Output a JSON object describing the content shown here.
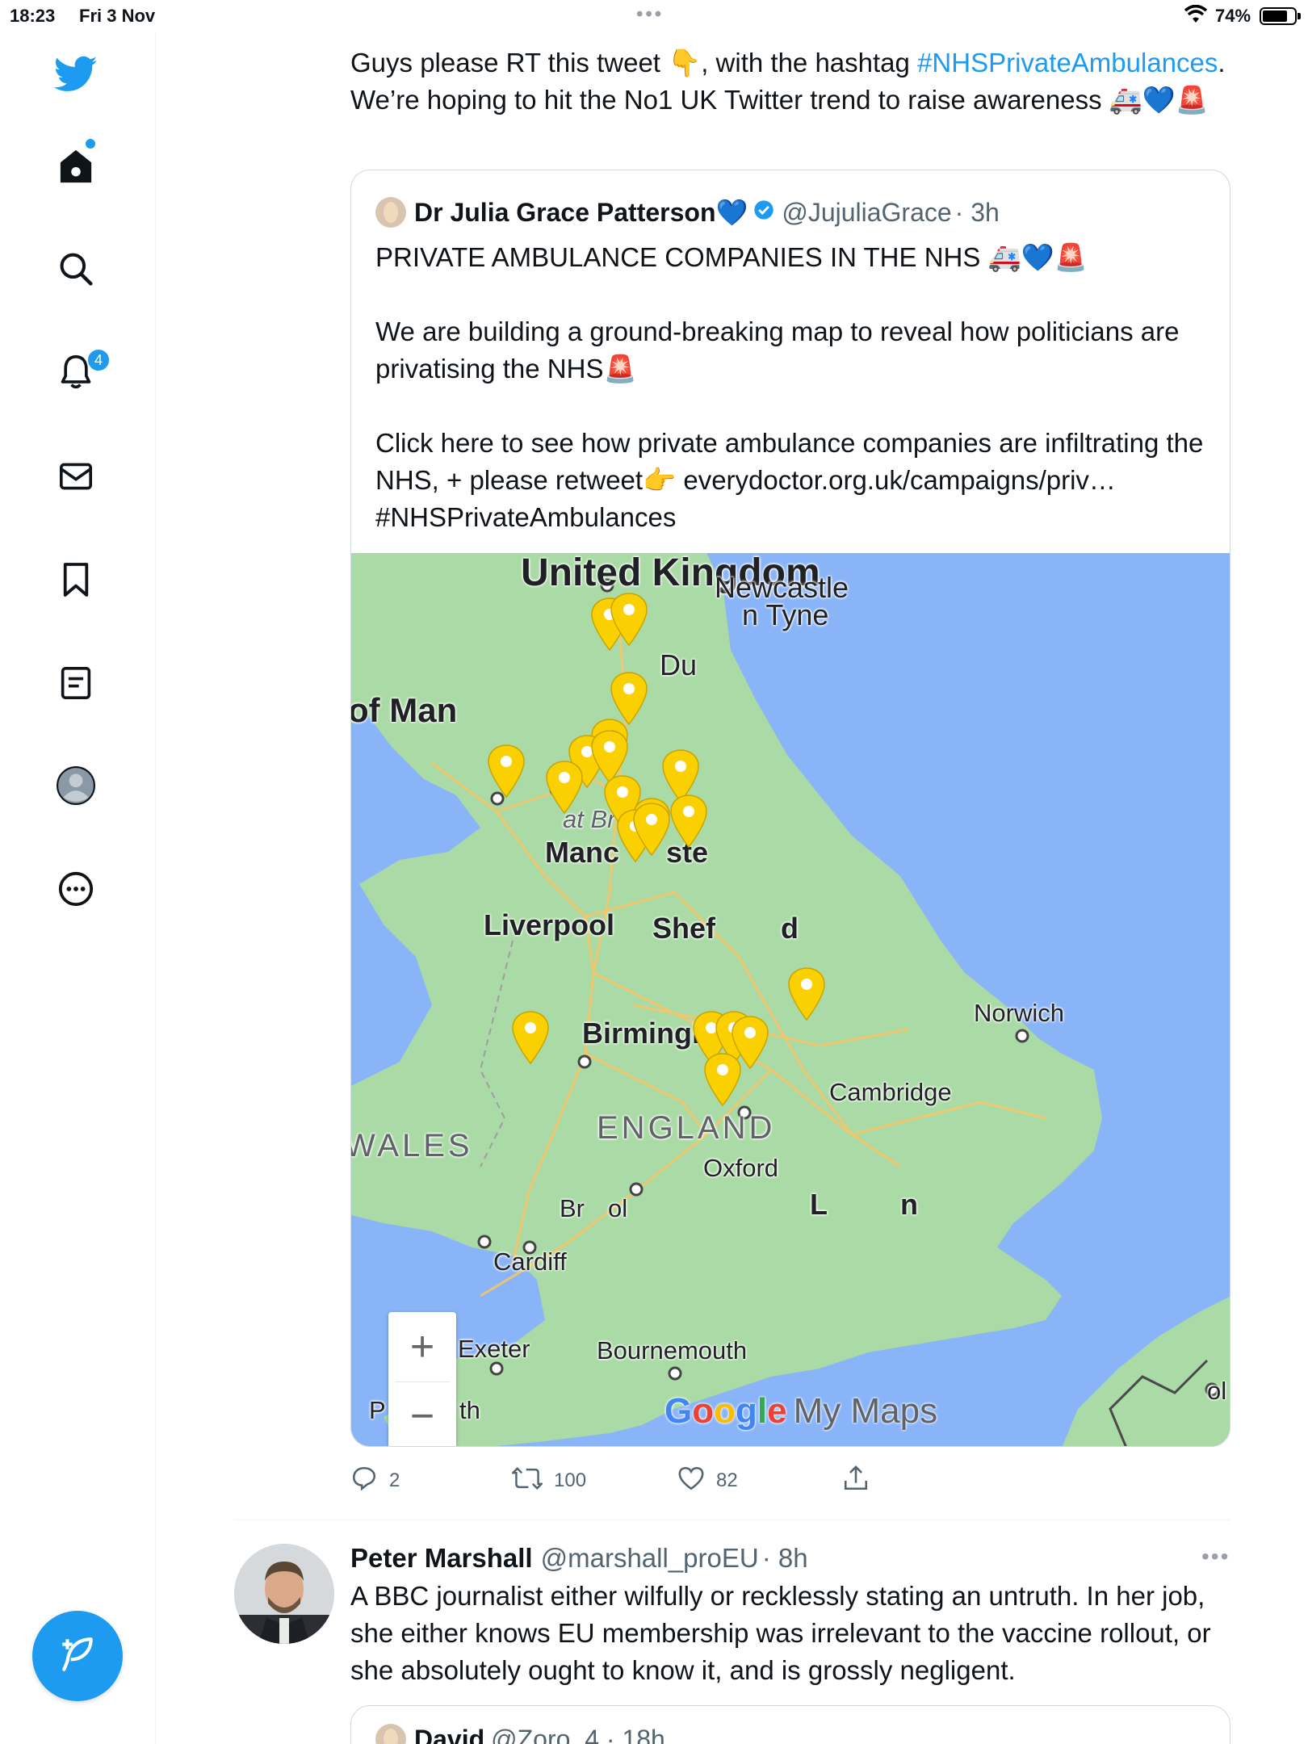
{
  "status_bar": {
    "time": "18:23",
    "date": "Fri 3 Nov",
    "battery": "74%"
  },
  "sidebar": {
    "items": [
      {
        "name": "Twitter",
        "icon": "twitter-bird-icon"
      },
      {
        "name": "Home",
        "icon": "home-icon"
      },
      {
        "name": "Search",
        "icon": "search-icon"
      },
      {
        "name": "Notifications",
        "icon": "bell-icon",
        "badge": "4"
      },
      {
        "name": "Messages",
        "icon": "mail-icon"
      },
      {
        "name": "Bookmarks",
        "icon": "bookmark-icon"
      },
      {
        "name": "Lists",
        "icon": "list-icon"
      },
      {
        "name": "Profile",
        "icon": "profile-icon"
      },
      {
        "name": "More",
        "icon": "more-icon"
      }
    ],
    "compose_icon": "feather-icon"
  },
  "tweet1": {
    "text_part1": "Guys please RT this tweet 👇, with the hashtag ",
    "hashtag": "#NHSPrivateAmbulances",
    "text_part2": ". We’re hoping to hit the No1 UK Twitter trend to raise awareness 🚑💙🚨",
    "quoted": {
      "name": "Dr Julia Grace Patterson💙",
      "handle": "@JujuliaGrace",
      "time": "· 3h",
      "para1": "PRIVATE AMBULANCE COMPANIES IN THE NHS 🚑💙🚨",
      "para2": "We are building a ground-breaking map to reveal how politicians are privatising the NHS🚨",
      "para3": "Click here to see how private ambulance companies are infiltrating the NHS, + please retweet👉 everydoctor.org.uk/campaigns/priv…",
      "para4": "#NHSPrivateAmbulances"
    },
    "map": {
      "labels": {
        "uk": "United Kingdom",
        "newcastle": "Newcastle",
        "tyne": "n Tyne",
        "durham": "Du",
        "isle_of_man": "of Man",
        "great_britain": "at Br",
        "manchester": "Manc",
        "manchester_end": "ste",
        "liverpool": "Liverpool",
        "sheffield": "Shef",
        "sheffield_end": "d",
        "norwich": "Norwich",
        "birmingham": "Birmingham",
        "cambridge": "Cambridge",
        "england": "ENGLAND",
        "wales": "WALES",
        "oxford": "Oxford",
        "london": "L",
        "london_end": "n",
        "bristol": "Br",
        "bristol_end": "ol",
        "cardiff": "Cardiff",
        "exeter": "Exeter",
        "bournemouth": "Bournemouth",
        "plymouth_start": "P",
        "plymouth_end": "th",
        "edge": "ol"
      },
      "zoom_in": "+",
      "zoom_out": "−",
      "brand": "Google",
      "brand_product": "My Maps",
      "pin_color": "#fbd000"
    },
    "actions": {
      "replies": "2",
      "retweets": "100",
      "likes": "82"
    }
  },
  "tweet2": {
    "name": "Peter Marshall",
    "handle": "@marshall_proEU",
    "time": "· 8h",
    "text": "A BBC journalist either wilfully or recklessly stating an untruth. In her job, she either knows EU membership was irrelevant to the vaccine rollout, or she absolutely ought to know it, and is grossly negligent.",
    "quoted_name": "David",
    "quoted_handle": "@Zoro_4 · 18h"
  },
  "colors": {
    "accent": "#1d9bf0",
    "text": "#0f1419",
    "secondary": "#536471",
    "land": "#aadaa5",
    "water": "#8ab4f8"
  }
}
